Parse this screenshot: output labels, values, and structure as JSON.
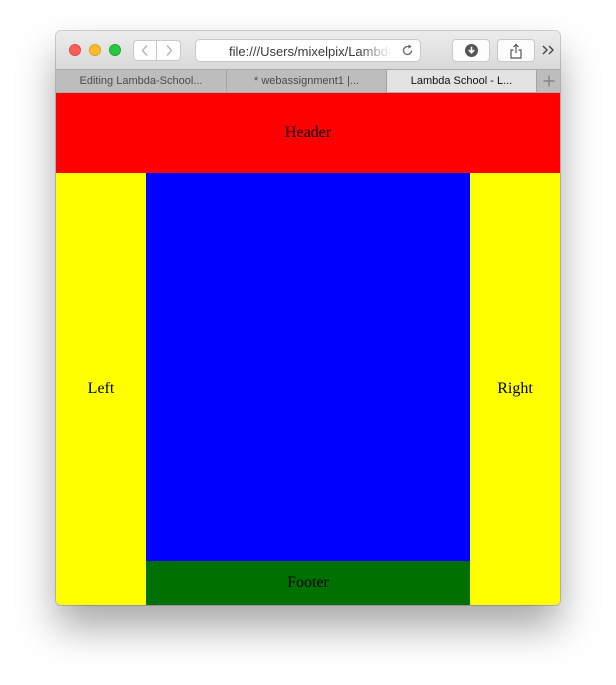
{
  "browser": {
    "address_bar": {
      "url": "file:///Users/mixelpix/Lambda-School"
    },
    "tabs": [
      {
        "label": "Editing Lambda-School..."
      },
      {
        "label": "* webassignment1 |..."
      },
      {
        "label": "Lambda School - L..."
      }
    ],
    "icons": {
      "back": "chevron-left-icon",
      "forward": "chevron-right-icon",
      "reload": "reload-icon",
      "download": "download-icon",
      "share": "share-icon",
      "more": "double-chevron-right-icon",
      "new_tab": "plus-icon"
    }
  },
  "page": {
    "header": {
      "label": "Header",
      "color": "#ff0000"
    },
    "left": {
      "label": "Left",
      "color": "#ffff00"
    },
    "main": {
      "label": "",
      "color": "#0000ff"
    },
    "right": {
      "label": "Right",
      "color": "#ffff00"
    },
    "footer": {
      "label": "Footer",
      "color": "#007000"
    }
  }
}
